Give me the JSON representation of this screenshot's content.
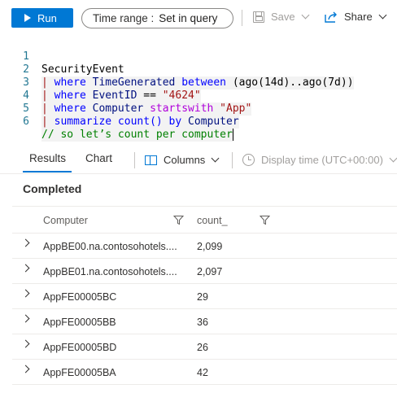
{
  "toolbar": {
    "run_label": "Run",
    "time_range_label": "Time range :",
    "time_range_value": "Set in query",
    "save_label": "Save",
    "share_label": "Share"
  },
  "editor": {
    "lines": [
      {
        "num": "1",
        "parts": [
          "SecurityEvent"
        ]
      },
      {
        "num": "2",
        "parts": [
          "|",
          " where",
          " TimeGenerated",
          " between",
          " (ago(14d)..ago(7d))"
        ]
      },
      {
        "num": "3",
        "parts": [
          "|",
          " where",
          " EventID",
          " == ",
          "\"4624\""
        ]
      },
      {
        "num": "4",
        "parts": [
          "|",
          " where",
          " Computer",
          " startswith",
          " \"App\""
        ]
      },
      {
        "num": "5",
        "parts": [
          "|",
          " summarize",
          " count()",
          " by",
          " Computer"
        ]
      },
      {
        "num": "6",
        "parts": [
          "// so let’s count per computer"
        ]
      }
    ]
  },
  "results": {
    "tabs": [
      "Results",
      "Chart"
    ],
    "columns_label": "Columns",
    "display_time_label": "Display time (UTC+00:00)",
    "status": "Completed",
    "headers": [
      "Computer",
      "count_"
    ],
    "rows": [
      {
        "computer": "AppBE00.na.contosohotels....",
        "count": "2,099"
      },
      {
        "computer": "AppBE01.na.contosohotels....",
        "count": "2,097"
      },
      {
        "computer": "AppFE00005BC",
        "count": "29"
      },
      {
        "computer": "AppFE00005BB",
        "count": "36"
      },
      {
        "computer": "AppFE00005BD",
        "count": "26"
      },
      {
        "computer": "AppFE00005BA",
        "count": "42"
      }
    ]
  },
  "colors": {
    "accent": "#0078d4",
    "comment": "#008000",
    "string": "#a31515",
    "keyword": "#0000ff"
  }
}
